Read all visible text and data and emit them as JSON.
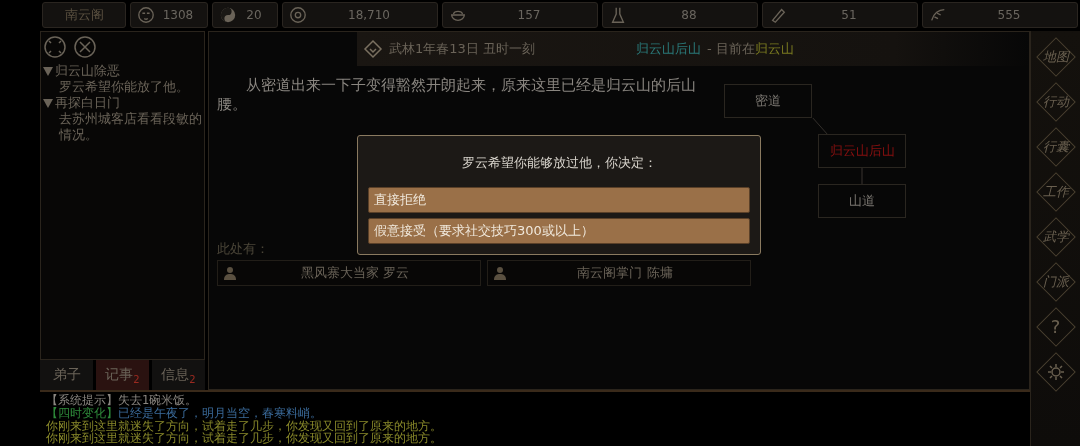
{
  "top_bar": {
    "sect": "南云阁",
    "stats": [
      {
        "kind": "mask",
        "value": "1308"
      },
      {
        "kind": "yinyang",
        "value": "20"
      },
      {
        "kind": "coin",
        "value": "18,710"
      },
      {
        "kind": "bowl",
        "value": "157"
      },
      {
        "kind": "flask",
        "value": "88"
      },
      {
        "kind": "scroll",
        "value": "51"
      },
      {
        "kind": "herb",
        "value": "555"
      }
    ]
  },
  "quests": [
    {
      "title": "归云山除恶",
      "desc": "罗云希望你能放了他。",
      "expanded": true
    },
    {
      "title": "再探白日门",
      "desc": "去苏州城客店看看段敏的情况。",
      "expanded": true
    }
  ],
  "left_tabs": [
    {
      "label": "弟子",
      "selected": false
    },
    {
      "label": "记事",
      "badge": "2",
      "selected": true
    },
    {
      "label": "信息",
      "badge": "2",
      "selected": false
    }
  ],
  "header": {
    "date": "武林1年春13日 丑时一刻",
    "location": "归云山后山",
    "separator": "- 目前在",
    "region": "归云山"
  },
  "description": "从密道出来一下子变得豁然开朗起来，原来这里已经是归云山的后山腰。",
  "map_nodes": [
    {
      "name": "密道",
      "current": false
    },
    {
      "name": "归云山后山",
      "current": true
    },
    {
      "name": "山道",
      "current": false
    }
  ],
  "here_label": "此处有：",
  "npcs": [
    {
      "name": "黑风寨大当家 罗云"
    },
    {
      "name": "南云阁掌门 陈墉"
    }
  ],
  "dialog": {
    "prompt": "罗云希望你能够放过他，你决定：",
    "options": [
      "直接拒绝",
      "假意接受（要求社交技巧300或以上）"
    ]
  },
  "side_menu": [
    {
      "kind": "text",
      "label": "地图"
    },
    {
      "kind": "text",
      "label": "行动"
    },
    {
      "kind": "text",
      "label": "行囊"
    },
    {
      "kind": "text",
      "label": "工作"
    },
    {
      "kind": "text",
      "label": "武学"
    },
    {
      "kind": "text",
      "label": "门派"
    },
    {
      "kind": "text",
      "label": "?"
    },
    {
      "kind": "gear"
    }
  ],
  "log": [
    {
      "kind": "system",
      "tag": "【系统提示】",
      "text": "失去1碗米饭。"
    },
    {
      "kind": "season",
      "tag": "【四时变化】",
      "text": "已经是午夜了，明月当空，春寒料峭。"
    },
    {
      "kind": "event",
      "text": "你刚来到这里就迷失了方向，试着走了几步，你发现又回到了原来的地方。"
    },
    {
      "kind": "event",
      "text": "你刚来到这里就迷失了方向，试着走了几步，你发现又回到了原来的地方。"
    }
  ]
}
